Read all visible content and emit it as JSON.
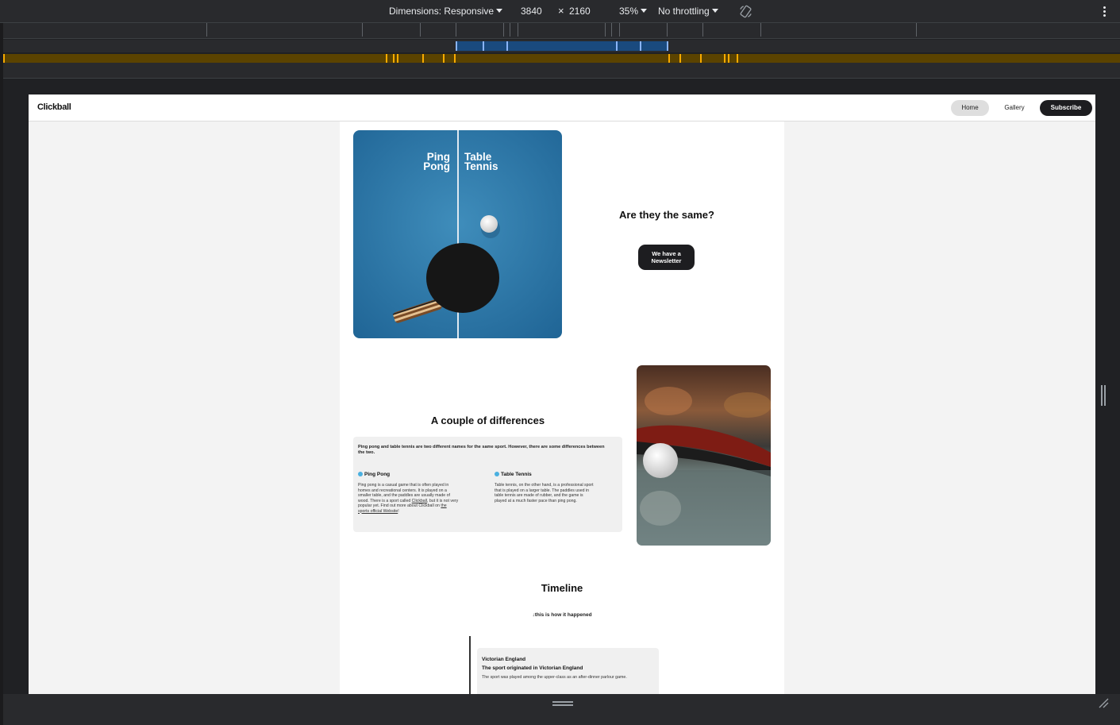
{
  "devtools": {
    "dimensions_label": "Dimensions: Responsive",
    "width": "3840",
    "times": "×",
    "height": "2160",
    "zoom": "35%",
    "throttling": "No throttling"
  },
  "site": {
    "brand": "Clickball",
    "nav": {
      "home": "Home",
      "gallery": "Gallery",
      "subscribe": "Subscribe"
    },
    "hero": {
      "img_left_line1": "Ping",
      "img_left_line2": "Pong",
      "img_right_line1": "Table",
      "img_right_line2": "Tennis",
      "title": "Are they the same?",
      "cta_line1": "We have a",
      "cta_line2": "Newsletter"
    },
    "differences": {
      "title": "A couple of differences",
      "intro": "Ping pong and table tennis are two different names for the same sport. However, there are some differences between the two.",
      "ping_pong": {
        "heading": "Ping Pong",
        "line1": "Ping pong is a casual game that is often played in",
        "line2": "homes and recreational centers. It is played on a",
        "line3": "smaller table, and the paddles are usually made of",
        "line4a": "wood. There is a sport called ",
        "line4_link": "Clickball",
        "line4b": ", but it is not very",
        "line5a": "popular yet. Find out more about Clickball on ",
        "line5_link": "the",
        "line6_link": "sports official Website",
        "line6b": "!"
      },
      "table_tennis": {
        "heading": "Table Tennis",
        "line1": "Table tennis, on the other hand, is a professional sport",
        "line2": "that is played on a larger table. The paddles used in",
        "line3": "table tennis are made of rubber, and the game is",
        "line4": "played at a much faster pace than ping pong."
      }
    },
    "timeline": {
      "title": "Timeline",
      "subtitle": "this is how it happened",
      "entry": {
        "era": "Victorian England",
        "heading": "The sport originated in Victorian England",
        "body": "The sport was played among the upper-class as an after-dinner parlour game."
      }
    }
  },
  "colors": {
    "devtools_bg": "#292a2d",
    "mq_blue": "#1a4a7e",
    "mq_gold": "#5b4300",
    "table_blue": "#2f79a8",
    "accent_dot": "#4ab0e0",
    "button_dark": "#1d1d20"
  },
  "icons": {
    "rotate": "rotate-icon",
    "more": "more-vert-icon",
    "caret": "caret-down-icon",
    "resize": "resize-corner-icon",
    "dot": "bullet-dot-icon",
    "arrow": "arrow-down-icon"
  }
}
